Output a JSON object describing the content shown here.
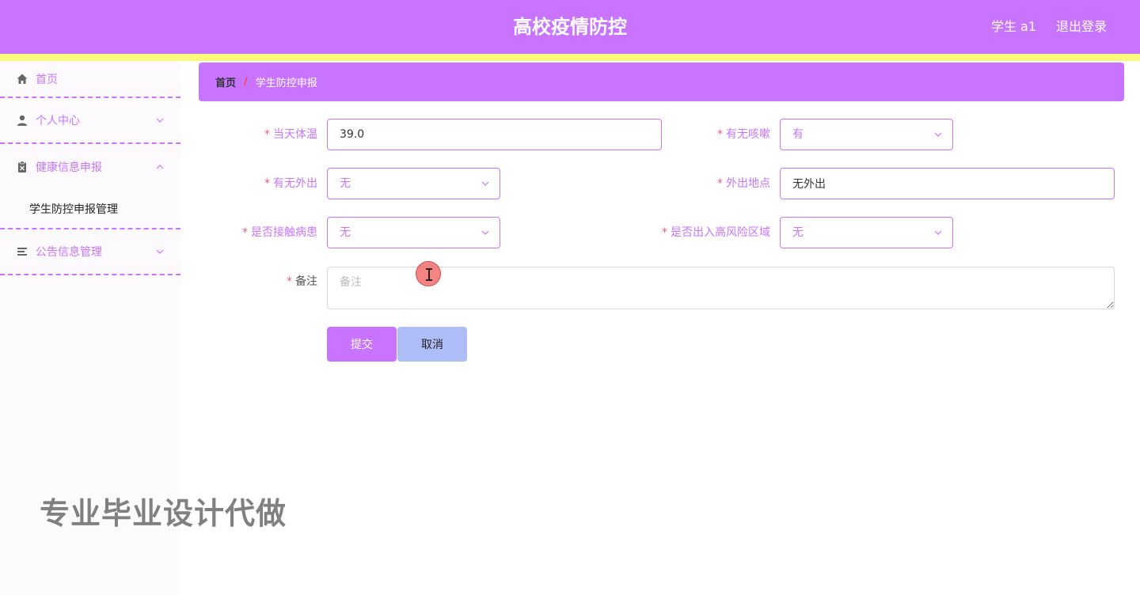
{
  "header": {
    "title": "高校疫情防控",
    "user": "学生 a1",
    "logout": "退出登录"
  },
  "sidebar": {
    "items": [
      {
        "label": "首页",
        "icon": "home-icon"
      },
      {
        "label": "个人中心",
        "icon": "user-icon"
      },
      {
        "label": "健康信息申报",
        "icon": "clipboard-icon",
        "expanded": true,
        "children": [
          {
            "label": "学生防控申报管理"
          }
        ]
      },
      {
        "label": "公告信息管理",
        "icon": "list-icon"
      }
    ]
  },
  "watermark": "专业毕业设计代做",
  "breadcrumb": {
    "home": "首页",
    "separator": "/",
    "current": "学生防控申报"
  },
  "form": {
    "required_mark": "*",
    "temperature": {
      "label": "当天体温",
      "value": "39.0"
    },
    "cough": {
      "label": "有无咳嗽",
      "value": "有"
    },
    "outing": {
      "label": "有无外出",
      "value": "无"
    },
    "outing_place": {
      "label": "外出地点",
      "value": "无外出"
    },
    "contact": {
      "label": "是否接触病患",
      "value": "无"
    },
    "high_risk": {
      "label": "是否出入高风险区域",
      "value": "无"
    },
    "remark": {
      "label": "备注",
      "placeholder": "备注"
    },
    "submit": "提交",
    "cancel": "取消"
  },
  "colors": {
    "primary": "#c874ff",
    "stripe": "#fbf87a",
    "cancel_button": "#aebcf8",
    "required": "#e85a8a",
    "breadcrumb_separator": "#ff3c3c"
  }
}
